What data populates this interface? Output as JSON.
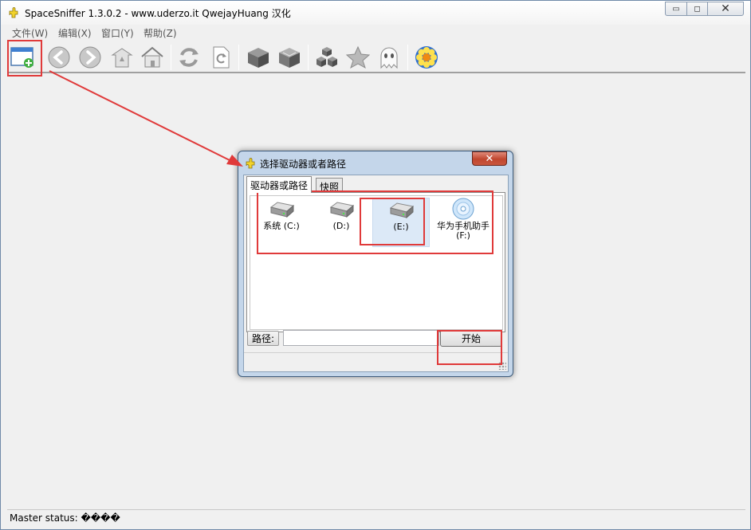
{
  "window": {
    "title": "SpaceSniffer 1.3.0.2 - www.uderzo.it  QwejayHuang 汉化",
    "controls": {
      "minimize": "▭",
      "maximize": "◻",
      "close": "✕"
    }
  },
  "menu": {
    "items": [
      "文件(W)",
      "编辑(X)",
      "窗口(Y)",
      "帮助(Z)"
    ]
  },
  "toolbar": {
    "buttons": [
      {
        "name": "new-window-icon"
      },
      {
        "name": "back-icon"
      },
      {
        "name": "forward-icon"
      },
      {
        "name": "up-folder-icon"
      },
      {
        "name": "home-icon"
      },
      {
        "name": "refresh-icon"
      },
      {
        "name": "refresh-page-icon"
      },
      {
        "name": "cube-icon"
      },
      {
        "name": "cube-filter-icon"
      },
      {
        "name": "cubes-icon"
      },
      {
        "name": "star-icon"
      },
      {
        "name": "ghost-icon"
      },
      {
        "name": "settings-flower-icon"
      }
    ]
  },
  "status": {
    "text": "Master status: ����"
  },
  "dialog": {
    "title": "选择驱动器或者路径",
    "close": "✕",
    "tabs": [
      {
        "label": "驱动器或路径",
        "active": true
      },
      {
        "label": "快照",
        "active": false
      }
    ],
    "drives": [
      {
        "label": "系统 (C:)",
        "type": "hard-disk",
        "selected": false
      },
      {
        "label": "(D:)",
        "type": "hard-disk",
        "selected": false
      },
      {
        "label": "(E:)",
        "type": "hard-disk",
        "selected": true
      },
      {
        "label": "华为手机助手 (F:)",
        "type": "cd-drive",
        "selected": false
      }
    ],
    "path_label": "路径:",
    "path_value": "",
    "start_label": "开始"
  },
  "colors": {
    "annotation": "#e03a3a",
    "selected_bg": "#dce9f7",
    "dialog_frame": "#c4d6ea"
  }
}
